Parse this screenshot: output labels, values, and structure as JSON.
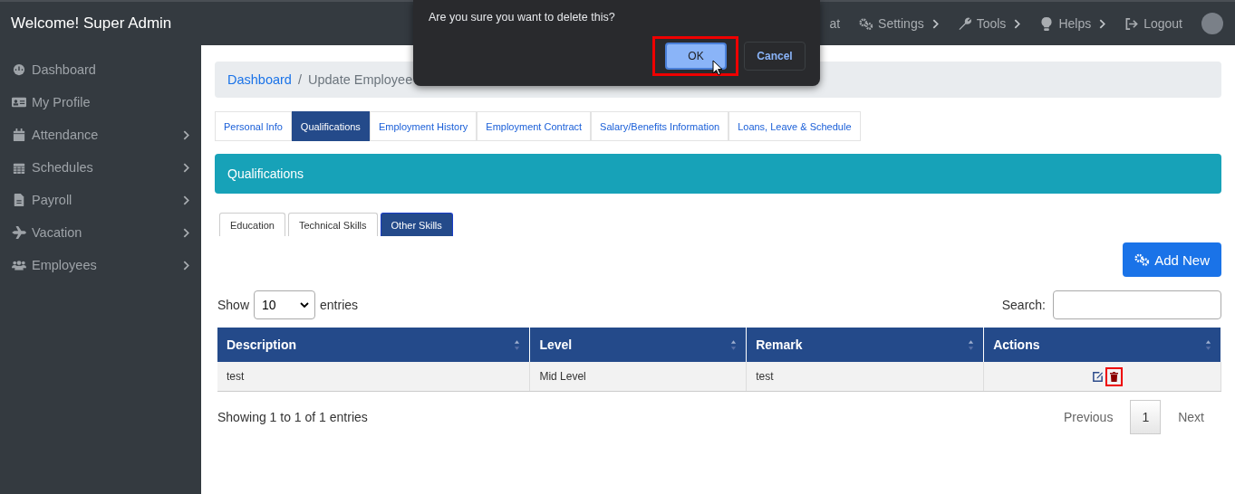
{
  "brand": "Welcome! Super Admin",
  "top_nav": [
    {
      "label": "at",
      "chevron": false
    },
    {
      "label": "Settings",
      "chevron": true
    },
    {
      "label": "Tools",
      "chevron": true
    },
    {
      "label": "Helps",
      "chevron": true
    },
    {
      "label": "Logout",
      "chevron": false
    }
  ],
  "sidebar": {
    "items": [
      {
        "label": "Dashboard",
        "chevron": false
      },
      {
        "label": "My Profile",
        "chevron": false
      },
      {
        "label": "Attendance",
        "chevron": true
      },
      {
        "label": "Schedules",
        "chevron": true
      },
      {
        "label": "Payroll",
        "chevron": true
      },
      {
        "label": "Vacation",
        "chevron": true
      },
      {
        "label": "Employees",
        "chevron": true
      }
    ]
  },
  "breadcrumb": {
    "separator": "/",
    "items": [
      {
        "label": "Dashboard",
        "link": true
      },
      {
        "label": "Update Employee",
        "link": false
      }
    ]
  },
  "tabs": [
    {
      "label": "Personal Info",
      "selected": false
    },
    {
      "label": "Qualifications",
      "selected": true
    },
    {
      "label": "Employment History",
      "selected": false
    },
    {
      "label": "Employment Contract",
      "selected": false
    },
    {
      "label": "Salary/Benefits Information",
      "selected": false
    },
    {
      "label": "Loans, Leave & Schedule",
      "selected": false
    }
  ],
  "panel_title": "Qualifications",
  "subtabs": [
    {
      "label": "Education",
      "selected": false
    },
    {
      "label": "Technical Skills",
      "selected": false
    },
    {
      "label": "Other Skills",
      "selected": true
    }
  ],
  "add_button": "Add New",
  "length_control": {
    "before": "Show",
    "value": "10",
    "after": "entries"
  },
  "search": {
    "label": "Search:"
  },
  "table": {
    "columns": [
      "Description",
      "Level",
      "Remark",
      "Actions"
    ],
    "rows": [
      {
        "cells": [
          "test",
          "Mid Level",
          "test"
        ],
        "delete_highlighted": true
      }
    ]
  },
  "info": "Showing 1 to 1 of 1 entries",
  "pagination": [
    {
      "label": "Previous",
      "selected": false
    },
    {
      "label": "1",
      "selected": true
    },
    {
      "label": "Next",
      "selected": false
    }
  ],
  "dialog": {
    "message": "Are you sure you want to delete this?",
    "ok": "OK",
    "cancel": "Cancel",
    "ok_highlighted": true
  }
}
